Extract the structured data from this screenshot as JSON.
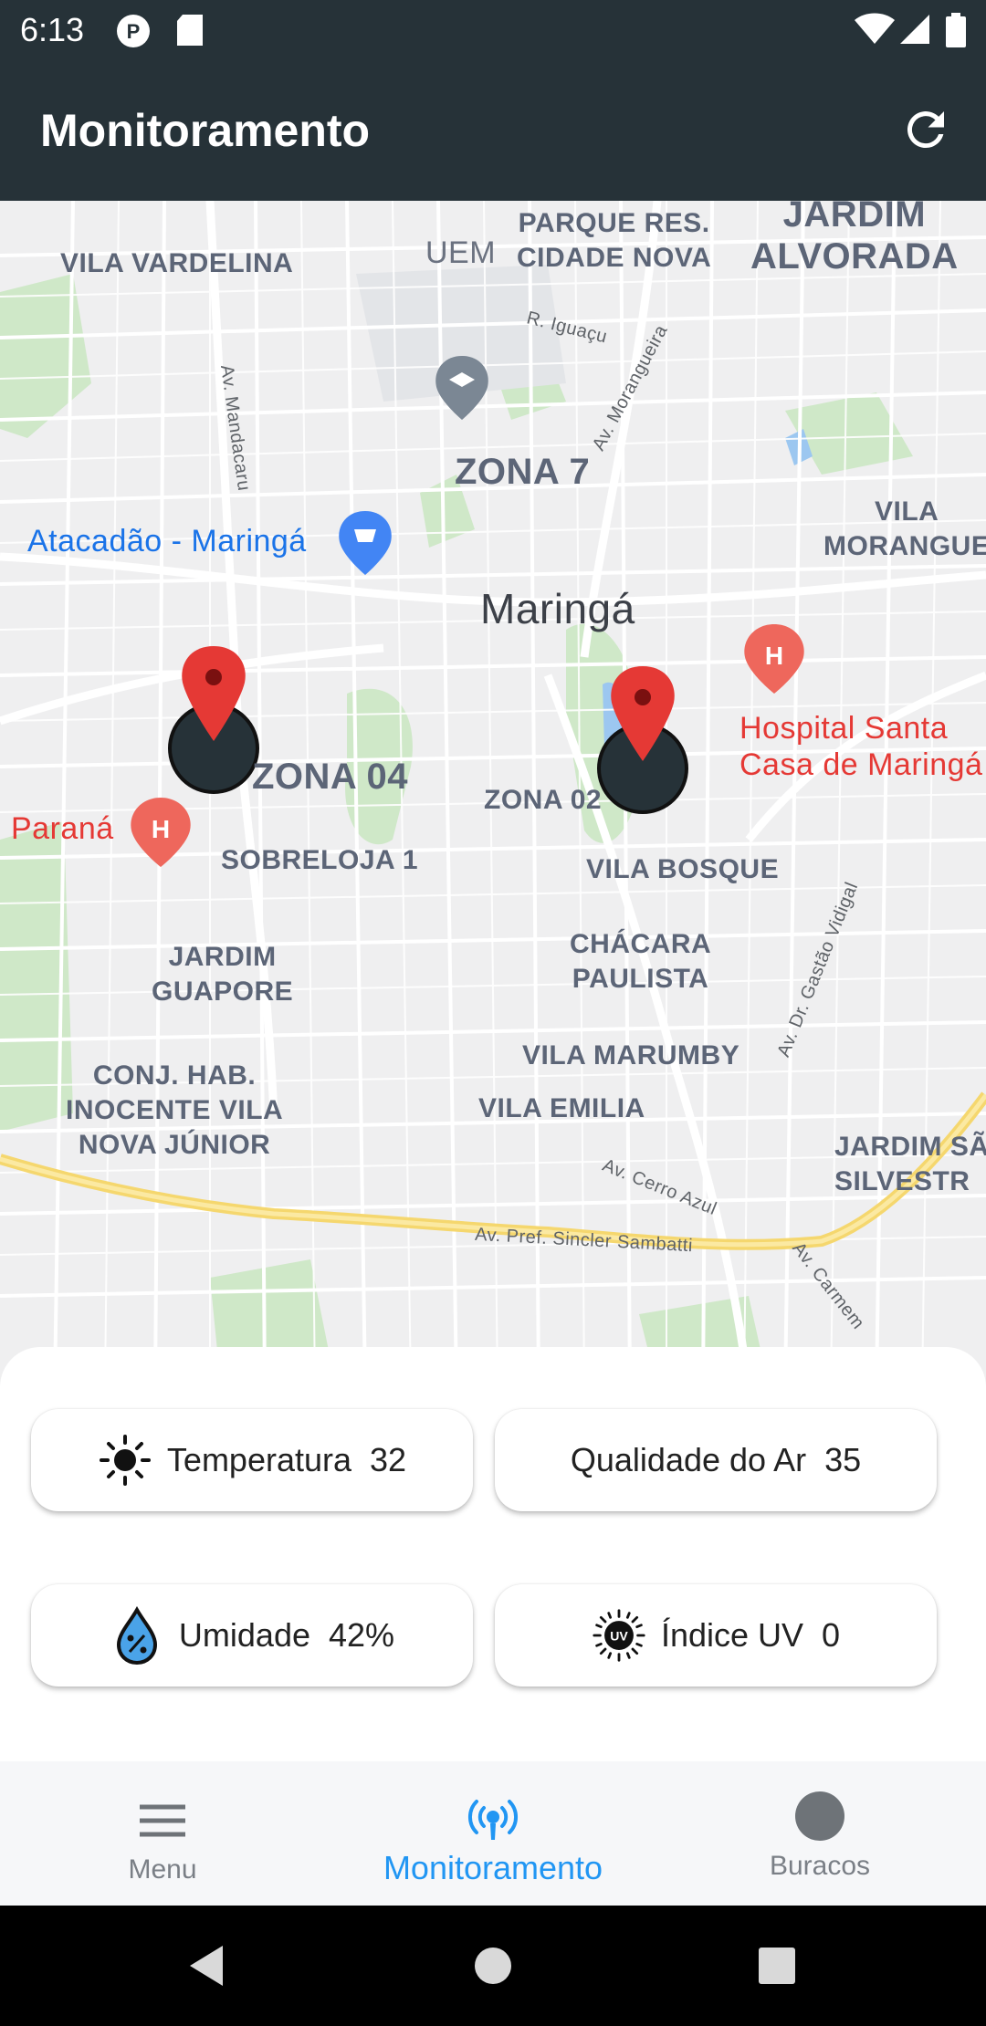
{
  "status_bar": {
    "time": "6:13"
  },
  "app_bar": {
    "title": "Monitoramento"
  },
  "map": {
    "labels": {
      "vila_vardelina": "VILA VARDELINA",
      "uem": "UEM",
      "parque_res": "PARQUE RES.\nCIDADE NOVA",
      "jardim_alvorada": "JARDIM\nALVORADA",
      "r_iguacu": "R. Iguaçu",
      "av_morangueira": "Av. Morangueira",
      "av_mandacaru": "Av. Mandacaru",
      "zona7": "ZONA 7",
      "atacadao": "Atacadão - Maringá",
      "vila_morangue": "VILA\nMORANGUE",
      "maringa": "Maringá",
      "hospital": "Hospital Santa\nCasa de Maringá",
      "zona04": "ZONA 04",
      "zona02": "ZONA 02",
      "parana": "l Paraná",
      "sobreloja": "SOBRELOJA 1",
      "vila_bosque": "VILA BOSQUE",
      "jardim_guapore": "JARDIM\nGUAPORE",
      "chacara": "CHÁCARA\nPAULISTA",
      "vila_marumby": "VILA MARUMBY",
      "conj_hab": "CONJ. HAB.\nINOCENTE VILA\nNOVA JÚNIOR",
      "vila_emilia": "VILA EMILIA",
      "av_gastao": "Av. Dr. Gastão Vidigal",
      "jardim_sao": "JARDIM SÃ\nSILVESTR",
      "av_cerro": "Av. Cerro Azul",
      "av_sincler": "Av. Pref. Sincler Sambatti",
      "av_carmem": "Av. Carmem"
    }
  },
  "metrics": {
    "temperatura": {
      "label": "Temperatura",
      "value": "32",
      "icon": "sun-icon"
    },
    "qualidade_ar": {
      "label": "Qualidade do Ar",
      "value": "35"
    },
    "umidade": {
      "label": "Umidade",
      "value": "42%",
      "icon": "humidity-drop-icon"
    },
    "indice_uv": {
      "label": "Índice UV",
      "value": "0",
      "icon": "uv-icon"
    }
  },
  "bottom_nav": {
    "items": [
      {
        "label": "Menu",
        "icon": "menu-icon"
      },
      {
        "label": "Monitoramento",
        "icon": "broadcast-icon",
        "active": true
      },
      {
        "label": "Buracos",
        "icon": "circle-icon"
      }
    ]
  },
  "colors": {
    "app_bar": "#263238",
    "accent": "#2196f3",
    "marker": "#e53935"
  }
}
